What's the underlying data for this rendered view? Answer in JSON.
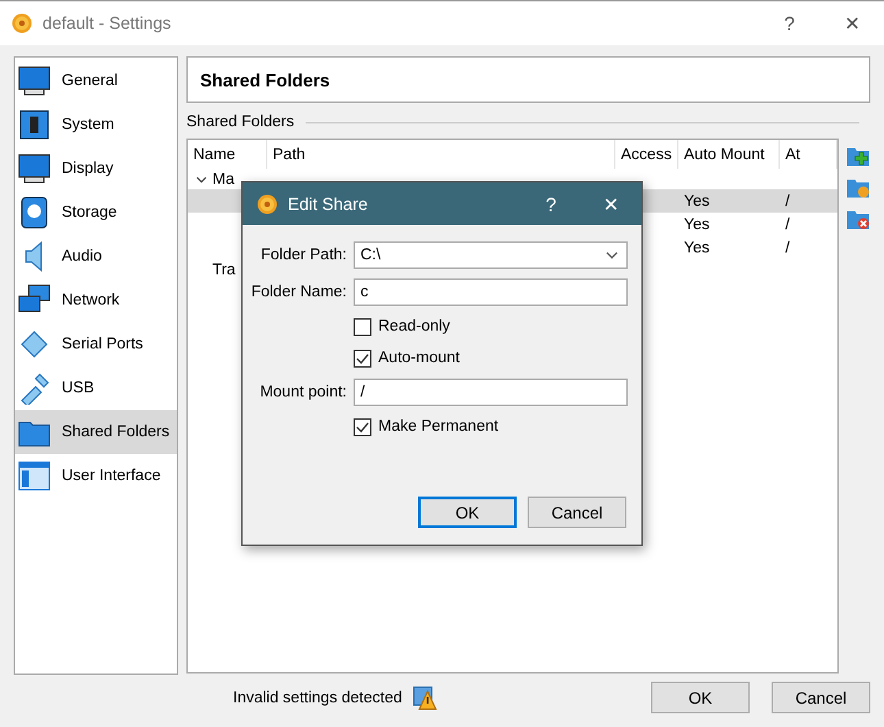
{
  "window": {
    "title": "default - Settings",
    "help": "?",
    "close": "✕"
  },
  "sidebar": {
    "items": [
      {
        "label": "General",
        "selected": false
      },
      {
        "label": "System",
        "selected": false
      },
      {
        "label": "Display",
        "selected": false
      },
      {
        "label": "Storage",
        "selected": false
      },
      {
        "label": "Audio",
        "selected": false
      },
      {
        "label": "Network",
        "selected": false
      },
      {
        "label": "Serial Ports",
        "selected": false
      },
      {
        "label": "USB",
        "selected": false
      },
      {
        "label": "Shared Folders",
        "selected": true
      },
      {
        "label": "User Interface",
        "selected": false
      }
    ]
  },
  "page": {
    "title": "Shared Folders",
    "group_label": "Shared Folders"
  },
  "table": {
    "columns": [
      "Name",
      "Path",
      "Access",
      "Auto Mount",
      "At"
    ],
    "groups": [
      {
        "label": "Ma",
        "expanded": true,
        "rows": [
          {
            "auto_mount": "Yes",
            "at": "/",
            "selected": true
          },
          {
            "auto_mount": "Yes",
            "at": "/",
            "selected": false
          },
          {
            "auto_mount": "Yes",
            "at": "/",
            "selected": false
          }
        ]
      },
      {
        "label": "Tra"
      }
    ]
  },
  "status": {
    "message": "Invalid settings detected"
  },
  "buttons": [
    {
      "label": "OK"
    },
    {
      "label": "Cancel"
    }
  ],
  "dialog": {
    "title": "Edit Share",
    "help": "?",
    "close": "✕",
    "fields": [
      {
        "kind": "combo",
        "label": "Folder Path:",
        "value": "C:\\"
      },
      {
        "kind": "text",
        "label": "Folder Name:",
        "value": "c"
      },
      {
        "kind": "checkbox",
        "label": "Read-only",
        "checked": false
      },
      {
        "kind": "checkbox",
        "label": "Auto-mount",
        "checked": true
      },
      {
        "kind": "text",
        "label": "Mount point:",
        "value": "/"
      },
      {
        "kind": "checkbox",
        "label": "Make Permanent",
        "checked": true
      }
    ],
    "buttons": [
      {
        "label": "OK",
        "default": true
      },
      {
        "label": "Cancel",
        "default": false
      }
    ]
  }
}
